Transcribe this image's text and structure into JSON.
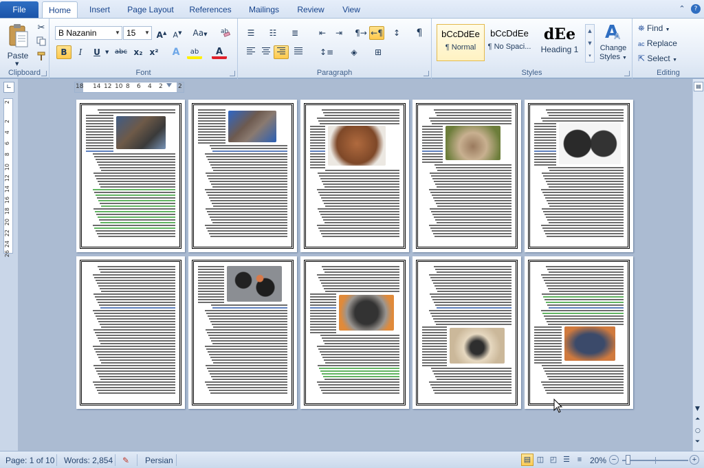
{
  "ribbon_tabs": {
    "file": "File",
    "home": "Home",
    "insert": "Insert",
    "page_layout": "Page Layout",
    "references": "References",
    "mailings": "Mailings",
    "review": "Review",
    "view": "View"
  },
  "clipboard": {
    "paste": "Paste",
    "group_label": "Clipboard"
  },
  "font": {
    "family": "B Nazanin",
    "size": "15",
    "grow": "A",
    "shrink": "A",
    "change_case": "Aa",
    "bold": "B",
    "italic": "I",
    "underline": "U",
    "strikethrough": "abc",
    "subscript": "x₂",
    "superscript": "x²",
    "text_effects": "A",
    "highlight": "ab",
    "font_color": "A",
    "group_label": "Font"
  },
  "paragraph": {
    "show_marks": "¶",
    "group_label": "Paragraph"
  },
  "styles": {
    "items": [
      {
        "sample": "bCcDdEe",
        "name": "¶ Normal"
      },
      {
        "sample": "bCcDdEe",
        "name": "¶ No Spaci..."
      },
      {
        "sample": "dEe",
        "name": "Heading 1"
      }
    ],
    "change_styles_line1": "Change",
    "change_styles_line2": "Styles",
    "group_label": "Styles"
  },
  "editing": {
    "find": "Find",
    "replace": "Replace",
    "select": "Select",
    "group_label": "Editing"
  },
  "ruler": {
    "h_ticks": [
      "18",
      "14",
      "12",
      "10",
      "8",
      "6",
      "4",
      "2",
      "2"
    ],
    "v_ticks": [
      "2",
      "2",
      "4",
      "6",
      "8",
      "10",
      "12",
      "14",
      "16",
      "18",
      "20",
      "22",
      "24",
      "26"
    ]
  },
  "status": {
    "page": "Page: 1 of 10",
    "words": "Words: 2,854",
    "language": "Persian",
    "zoom": "20%"
  },
  "colors": {
    "file_tab": "#1b54a8",
    "ribbon_bg": "#e4ecf7",
    "workspace": "#abbbd2",
    "active_button": "#ffc94d"
  }
}
